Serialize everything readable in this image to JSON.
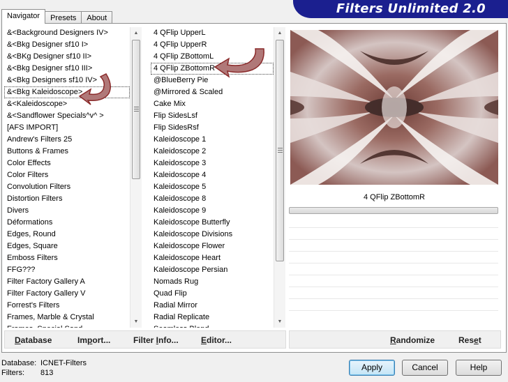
{
  "tabs": [
    {
      "label": "Navigator",
      "active": true
    },
    {
      "label": "Presets",
      "active": false
    },
    {
      "label": "About",
      "active": false
    }
  ],
  "banner": {
    "title": "Filters Unlimited 2.0",
    "color": "#1b1f8f"
  },
  "categories": {
    "items": [
      "&<Background Designers IV>",
      "&<Bkg Designer sf10 I>",
      "&<BKg Designer sf10 II>",
      "&<Bkg Designer sf10 III>",
      "&<Bkg Designers sf10 IV>",
      "&<Bkg Kaleidoscope>",
      "&<Kaleidoscope>",
      "&<Sandflower Specials^v^ >",
      "[AFS IMPORT]",
      "Andrew's Filters 25",
      "Buttons & Frames",
      "Color Effects",
      "Color Filters",
      "Convolution Filters",
      "Distortion Filters",
      "Divers",
      "Déformations",
      "Edges, Round",
      "Edges, Square",
      "Emboss Filters",
      "FFG???",
      "Filter Factory Gallery A",
      "Filter Factory Gallery V",
      "Forrest's Filters",
      "Frames, Marble & Crystal",
      "Frames, Special Sand"
    ],
    "selected_index": 5
  },
  "filters": {
    "items": [
      "4 QFlip UpperL",
      "4 QFlip UpperR",
      "4 QFlip ZBottomL",
      "4 QFlip ZBottomR",
      "@BlueBerry Pie",
      "@Mirrored & Scaled",
      "Cake Mix",
      "Flip SidesLsf",
      "Flip SidesRsf",
      "Kaleidoscope 1",
      "Kaleidoscope 2",
      "Kaleidoscope 3",
      "Kaleidoscope 4",
      "Kaleidoscope 5",
      "Kaleidoscope 8",
      "Kaleidoscope 9",
      "Kaleidoscope Butterfly",
      "Kaleidoscope Divisions",
      "Kaleidoscope Flower",
      "Kaleidoscope Heart",
      "Kaleidoscope Persian",
      "Nomads Rug",
      "Quad Flip",
      "Radial Mirror",
      "Radial Replicate",
      "Seamless Blend"
    ],
    "selected_index": 3
  },
  "preview": {
    "filter_name": "4 QFlip ZBottomR"
  },
  "commands_left": {
    "database": {
      "pre": "",
      "ul": "D",
      "post": "atabase"
    },
    "import": {
      "pre": "Im",
      "ul": "p",
      "post": "ort..."
    },
    "filter_info": {
      "pre": "Filter ",
      "ul": "I",
      "post": "nfo..."
    },
    "editor": {
      "pre": "",
      "ul": "E",
      "post": "ditor..."
    }
  },
  "commands_right": {
    "randomize": {
      "pre": "",
      "ul": "R",
      "post": "andomize"
    },
    "reset": {
      "pre": "Res",
      "ul": "e",
      "post": "t"
    }
  },
  "status": {
    "database_label": "Database:",
    "database_value": "ICNET-Filters",
    "filters_label": "Filters:",
    "filters_value": "813"
  },
  "buttons": {
    "apply": "Apply",
    "cancel": "Cancel",
    "help": "Help"
  },
  "colors": {
    "arrow_fill": "#b07878",
    "arrow_stroke": "#8a2a2a"
  }
}
